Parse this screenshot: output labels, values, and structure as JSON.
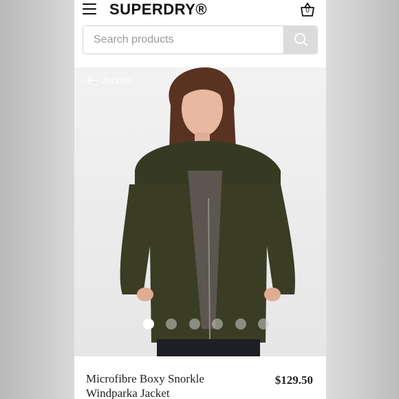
{
  "brand": "SUPERDRY®",
  "bag": {
    "count": "0",
    "icon": "shopping-bag-icon"
  },
  "menu": {
    "icon": "hamburger-menu-icon"
  },
  "search": {
    "placeholder": "Search products",
    "value": "",
    "icon": "search-icon"
  },
  "breadcrumb": {
    "label": "Jackets",
    "icon": "arrow-left-icon"
  },
  "gallery": {
    "slides": 6,
    "active_index": 0
  },
  "product": {
    "name": "Microfibre Boxy Snorkle Windparka Jacket",
    "price": "$129.50"
  },
  "colors": {
    "jacket": "#3a3d24",
    "search_button": "#dcdcdc",
    "text": "#222222"
  }
}
